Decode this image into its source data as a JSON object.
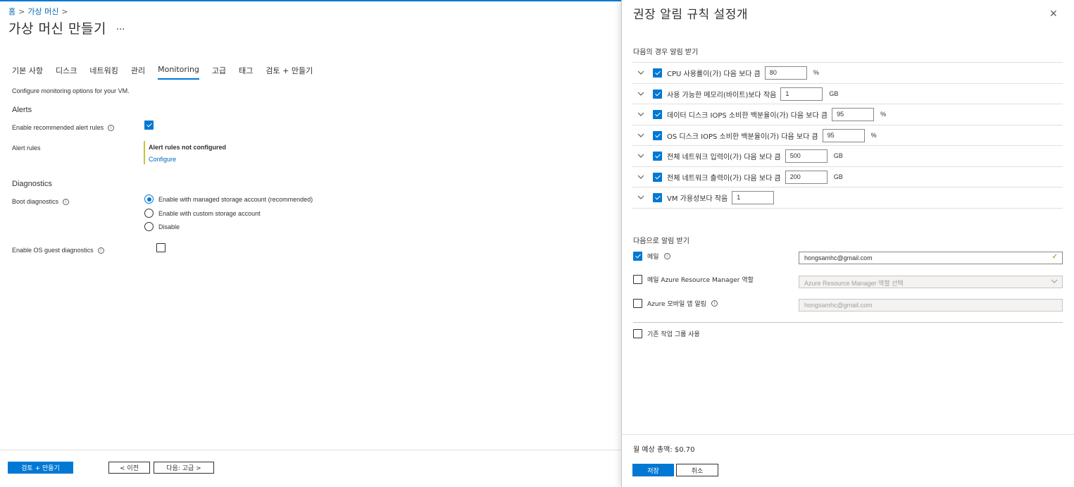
{
  "breadcrumb": {
    "home": "홈",
    "vm": "가상 머신",
    "sep": ">"
  },
  "page": {
    "title": "가상 머신 만들기",
    "more": "..."
  },
  "tabs": [
    {
      "label": "기본 사항"
    },
    {
      "label": "디스크"
    },
    {
      "label": "네트워킹"
    },
    {
      "label": "관리"
    },
    {
      "label": "Monitoring"
    },
    {
      "label": "고급"
    },
    {
      "label": "태그"
    },
    {
      "label": "검토 + 만들기"
    }
  ],
  "monitoring": {
    "description": "Configure monitoring options for your VM.",
    "alerts_heading": "Alerts",
    "enable_recommended_label": "Enable recommended alert rules",
    "enable_recommended_checked": true,
    "alert_rules_label": "Alert rules",
    "alert_rules_status": "Alert rules not configured",
    "configure_link": "Configure",
    "diagnostics_heading": "Diagnostics",
    "boot_diag_label": "Boot diagnostics",
    "boot_options": [
      {
        "label": "Enable with managed storage account (recommended)",
        "selected": true
      },
      {
        "label": "Enable with custom storage account",
        "selected": false
      },
      {
        "label": "Disable",
        "selected": false
      }
    ],
    "os_guest_label": "Enable OS guest diagnostics",
    "os_guest_checked": false
  },
  "footer": {
    "review_create": "검토 + 만들기",
    "prev": "< 이전",
    "next": "다음: 고급 >"
  },
  "panel": {
    "title": "권장 알림 규칙 설정개",
    "close": "✕",
    "alert_when_heading": "다음의 경우 알림 받기",
    "rules": [
      {
        "label": "CPU 사용률이(가) 다음 보다 큼",
        "value": "80",
        "unit": "%"
      },
      {
        "label": "사용 가능한 메모리(바이트)보다 작음",
        "value": "1",
        "unit": "GB"
      },
      {
        "label": "데이터 디스크 IOPS 소비한 백분율이(가) 다음 보다 큼",
        "value": "95",
        "unit": "%"
      },
      {
        "label": "OS 디스크 IOPS 소비한 백분율이(가) 다음 보다 큼",
        "value": "95",
        "unit": "%"
      },
      {
        "label": "전체 네트워크 입력이(가) 다음 보다 큼",
        "value": "500",
        "unit": "GB"
      },
      {
        "label": "전체 네트워크 출력이(가) 다음 보다 큼",
        "value": "200",
        "unit": "GB"
      },
      {
        "label": "VM 가용성보다 작음",
        "value": "1",
        "unit": ""
      }
    ],
    "notify_heading": "다음으로 알림 받기",
    "email_label": "메일",
    "email_checked": true,
    "email_value": "hongsamhc@gmail.com",
    "arm_role_label": "메일 Azure Resource Manager 역할",
    "arm_role_checked": false,
    "arm_role_placeholder": "Azure Resource Manager 역할 선택",
    "mobile_label": "Azure 모바일 앱 알림",
    "mobile_checked": false,
    "mobile_value": "hongsamhc@gmail.com",
    "existing_group_label": "기존 작업 그룹 사용",
    "existing_group_checked": false,
    "cost_label": "월 예상 총액: $0.70",
    "save": "저장",
    "cancel": "취소"
  },
  "colors": {
    "accent": "#0078d4",
    "alert_bar": "#c8c33d",
    "valid": "#57a300"
  }
}
